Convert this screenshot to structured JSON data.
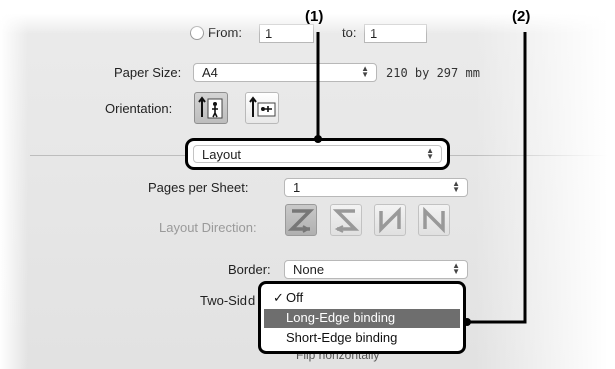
{
  "top_row": {
    "from_label": "From:",
    "from_value": "1",
    "to_label": "to:",
    "to_value": "1"
  },
  "paper_size": {
    "label": "Paper Size:",
    "value": "A4",
    "dimensions": "210 by 297 mm"
  },
  "orientation": {
    "label": "Orientation:",
    "options": [
      "portrait",
      "landscape"
    ],
    "selected": "portrait"
  },
  "section_popup": {
    "value": "Layout"
  },
  "pages_per_sheet": {
    "label": "Pages per Sheet:",
    "value": "1"
  },
  "layout_direction": {
    "label": "Layout Direction:",
    "options": [
      "Z",
      "S",
      "N-reverse",
      "N"
    ],
    "selected": "Z"
  },
  "border": {
    "label": "Border:",
    "value": "None"
  },
  "two_sided": {
    "label": "Two-Sid",
    "label_suffix": "d",
    "menu": [
      {
        "label": "Off",
        "checked": true,
        "highlighted": false
      },
      {
        "label": "Long-Edge binding",
        "checked": false,
        "highlighted": true
      },
      {
        "label": "Short-Edge binding",
        "checked": false,
        "highlighted": false
      }
    ],
    "hidden_text": "Flip horizontally"
  },
  "callouts": {
    "one": "(1)",
    "two": "(2)"
  },
  "colors": {
    "highlight": "#6e6e6e",
    "callout": "#000000",
    "panel": "#e6e6e6"
  }
}
